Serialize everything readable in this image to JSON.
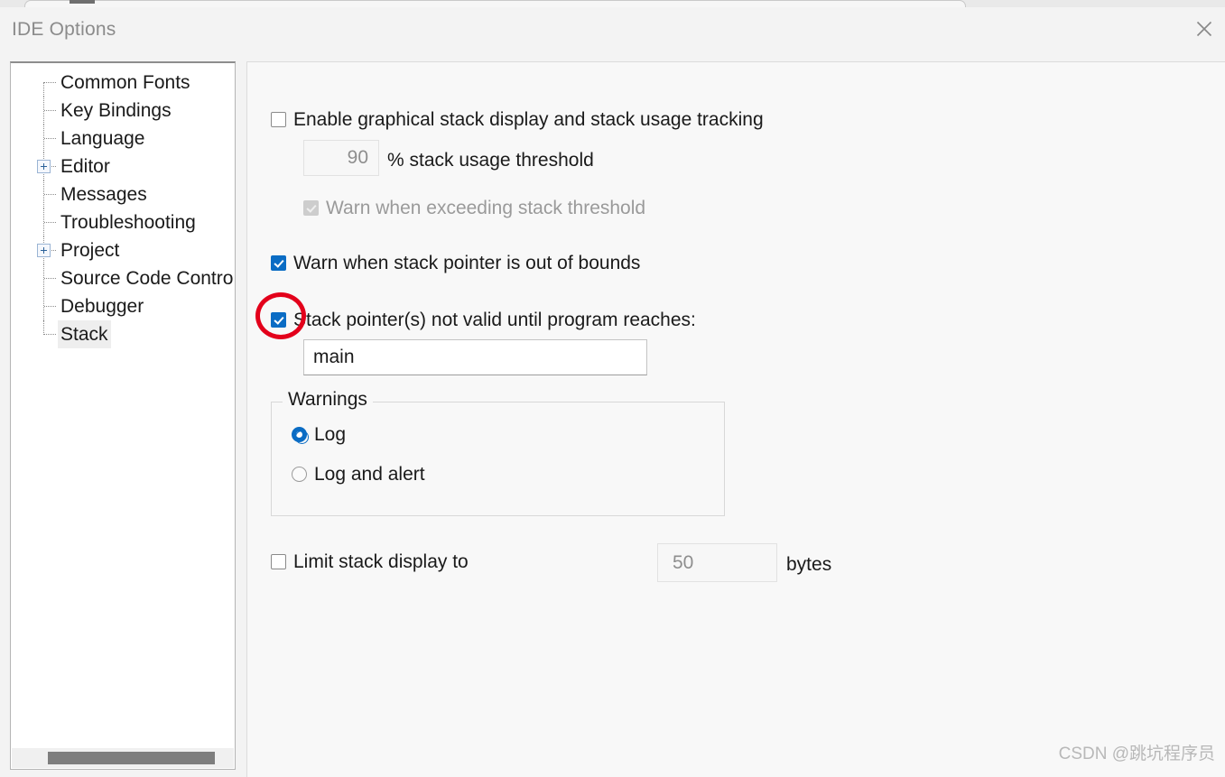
{
  "window": {
    "title": "IDE Options",
    "close_icon": "close-icon"
  },
  "sidebar": {
    "items": [
      {
        "label": "Common Fonts",
        "expandable": false,
        "selected": false
      },
      {
        "label": "Key Bindings",
        "expandable": false,
        "selected": false
      },
      {
        "label": "Language",
        "expandable": false,
        "selected": false
      },
      {
        "label": "Editor",
        "expandable": true,
        "selected": false
      },
      {
        "label": "Messages",
        "expandable": false,
        "selected": false
      },
      {
        "label": "Troubleshooting",
        "expandable": false,
        "selected": false
      },
      {
        "label": "Project",
        "expandable": true,
        "selected": false
      },
      {
        "label": "Source Code Contro",
        "expandable": false,
        "selected": false
      },
      {
        "label": "Debugger",
        "expandable": false,
        "selected": false
      },
      {
        "label": "Stack",
        "expandable": false,
        "selected": true
      }
    ],
    "scrollbar": "horizontal-scrollbar"
  },
  "main": {
    "enable_graphical": {
      "label": "Enable graphical stack display and stack usage tracking",
      "checked": false
    },
    "threshold": {
      "value": "90",
      "label": "% stack usage threshold"
    },
    "warn_exceeding": {
      "label": "Warn when exceeding stack threshold",
      "checked": true,
      "disabled": true
    },
    "warn_out_of_bounds": {
      "label": "Warn when stack pointer is out of bounds",
      "checked": true
    },
    "sp_not_valid": {
      "label": "Stack pointer(s) not valid until program reaches:",
      "checked": true
    },
    "sp_symbol": {
      "value": "main"
    },
    "warnings_group": {
      "title": "Warnings",
      "options": [
        {
          "label": "Log",
          "selected": true
        },
        {
          "label": "Log and alert",
          "selected": false
        }
      ]
    },
    "limit_stack": {
      "label": "Limit stack display to",
      "checked": false,
      "value": "50",
      "unit": "bytes"
    }
  },
  "watermark": {
    "text": "CSDN @跳坑程序员"
  },
  "colors": {
    "accent": "#0a6cc4",
    "annotation": "#e3001b",
    "panel_bg": "#f8f8f8",
    "dialog_bg": "#f3f3f3"
  }
}
